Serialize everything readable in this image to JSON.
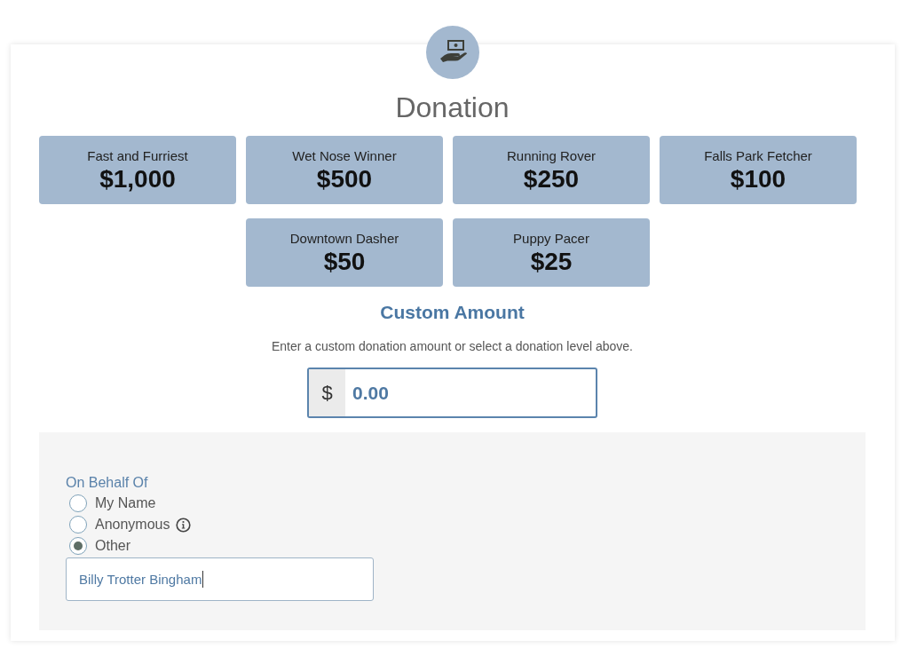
{
  "header": {
    "title": "Donation"
  },
  "levels": [
    {
      "name": "Fast and Furriest",
      "amount": "$1,000",
      "selected": false
    },
    {
      "name": "Wet Nose Winner",
      "amount": "$500",
      "selected": false
    },
    {
      "name": "Running Rover",
      "amount": "$250",
      "selected": false
    },
    {
      "name": "Falls Park Fetcher",
      "amount": "$100",
      "selected": false
    },
    {
      "name": "Downtown Dasher",
      "amount": "$50",
      "selected": false
    },
    {
      "name": "Puppy Pacer",
      "amount": "$25",
      "selected": false
    }
  ],
  "custom_amount": {
    "title": "Custom Amount",
    "hint": "Enter a custom donation amount or select a donation level above.",
    "currency": "$",
    "value": "0.00"
  },
  "on_behalf_of": {
    "label": "On Behalf Of",
    "options": [
      {
        "label": "My Name",
        "selected": false,
        "info": false
      },
      {
        "label": "Anonymous",
        "selected": false,
        "info": true
      },
      {
        "label": "Other",
        "selected": true,
        "info": false
      }
    ],
    "other_name": {
      "value": "Billy Trotter Bingham"
    }
  }
}
